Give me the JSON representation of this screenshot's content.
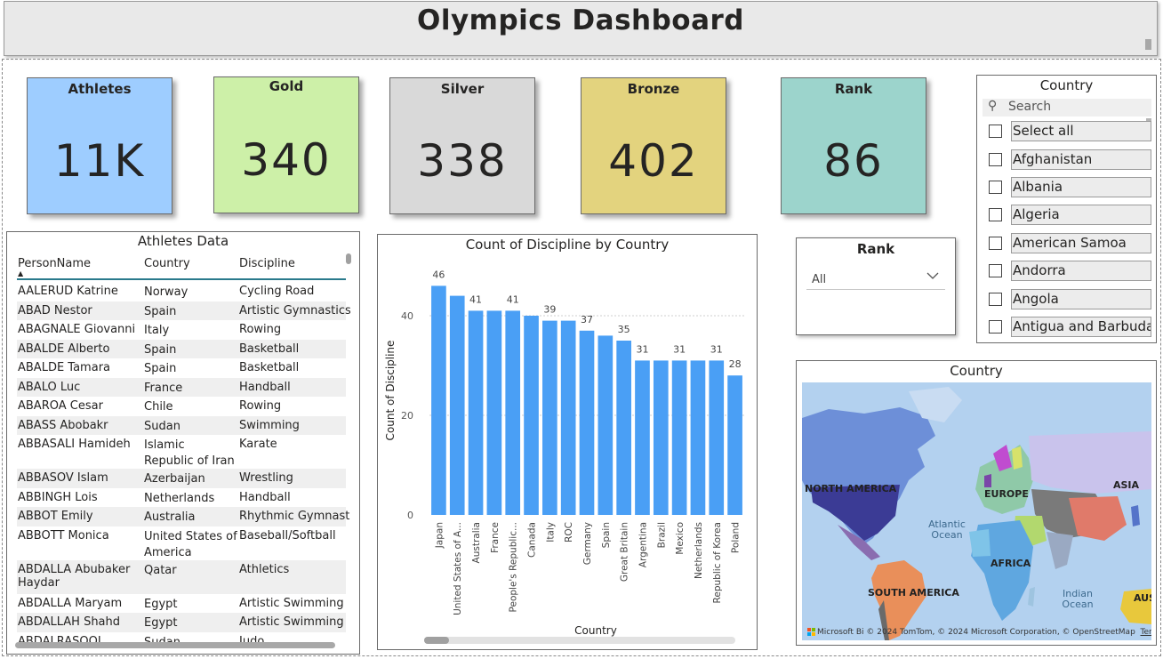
{
  "header": {
    "title": "Olympics Dashboard"
  },
  "kpis": [
    {
      "label": "Athletes",
      "value": "11K",
      "color": "#9ecdff"
    },
    {
      "label": "Gold",
      "value": "340",
      "color": "#cdf0a8"
    },
    {
      "label": "Silver",
      "value": "338",
      "color": "#d9d9d9"
    },
    {
      "label": "Bronze",
      "value": "402",
      "color": "#e3d37e"
    },
    {
      "label": "Rank",
      "value": "86",
      "color": "#9cd4cc"
    }
  ],
  "country_slicer": {
    "title": "Country",
    "search_placeholder": "Search",
    "items": [
      "Select all",
      "Afghanistan",
      "Albania",
      "Algeria",
      "American Samoa",
      "Andorra",
      "Angola",
      "Antigua and Barbuda"
    ]
  },
  "rank_slicer": {
    "title": "Rank",
    "value": "All"
  },
  "athletes_table": {
    "title": "Athletes Data",
    "columns": [
      "PersonName",
      "Country",
      "Discipline"
    ],
    "rows": [
      [
        "AALERUD Katrine",
        "Norway",
        "Cycling Road"
      ],
      [
        "ABAD Nestor",
        "Spain",
        "Artistic Gymnastics"
      ],
      [
        "ABAGNALE Giovanni",
        "Italy",
        "Rowing"
      ],
      [
        "ABALDE Alberto",
        "Spain",
        "Basketball"
      ],
      [
        "ABALDE Tamara",
        "Spain",
        "Basketball"
      ],
      [
        "ABALO Luc",
        "France",
        "Handball"
      ],
      [
        "ABAROA Cesar",
        "Chile",
        "Rowing"
      ],
      [
        "ABASS Abobakr",
        "Sudan",
        "Swimming"
      ],
      [
        "ABBASALI Hamideh",
        "Islamic Republic of Iran",
        "Karate"
      ],
      [
        "ABBASOV Islam",
        "Azerbaijan",
        "Wrestling"
      ],
      [
        "ABBINGH Lois",
        "Netherlands",
        "Handball"
      ],
      [
        "ABBOT Emily",
        "Australia",
        "Rhythmic Gymnastic"
      ],
      [
        "ABBOTT Monica",
        "United States of America",
        "Baseball/Softball"
      ],
      [
        "ABDALLA Abubaker Haydar",
        "Qatar",
        "Athletics"
      ],
      [
        "ABDALLA Maryam",
        "Egypt",
        "Artistic Swimming"
      ],
      [
        "ABDALLAH Shahd",
        "Egypt",
        "Artistic Swimming"
      ],
      [
        "ABDALRASOOL",
        "Sudan",
        "Judo"
      ]
    ]
  },
  "chart_data": {
    "type": "bar",
    "title": "Count of Discipline by Country",
    "xlabel": "Country",
    "ylabel": "Count of Discipline",
    "categories": [
      "Japan",
      "United States of A...",
      "Australia",
      "France",
      "People's Republic...",
      "Canada",
      "Italy",
      "ROC",
      "Germany",
      "Spain",
      "Great Britain",
      "Argentina",
      "Brazil",
      "Mexico",
      "Netherlands",
      "Republic of Korea",
      "Poland"
    ],
    "values": [
      46,
      44,
      41,
      41,
      41,
      40,
      39,
      39,
      37,
      36,
      35,
      31,
      31,
      31,
      31,
      31,
      28
    ],
    "data_labels": [
      "46",
      "",
      "41",
      "",
      "41",
      "",
      "39",
      "",
      "37",
      "",
      "35",
      "31",
      "",
      "31",
      "",
      "31",
      "28"
    ],
    "yticks": [
      0,
      20,
      40
    ],
    "ylim": [
      0,
      50
    ],
    "color": "#4a9ff5",
    "grid": true
  },
  "map": {
    "title": "Country",
    "regions": [
      "NORTH AMERICA",
      "EUROPE",
      "ASIA",
      "AFRICA",
      "SOUTH AMERICA",
      "AUS"
    ],
    "oceans": [
      "Atlantic Ocean",
      "Indian Ocean"
    ],
    "attribution": "© 2024 TomTom, © 2024 Microsoft Corporation, © OpenStreetMap",
    "terms": "Terms",
    "brand": "Microsoft Bi"
  }
}
